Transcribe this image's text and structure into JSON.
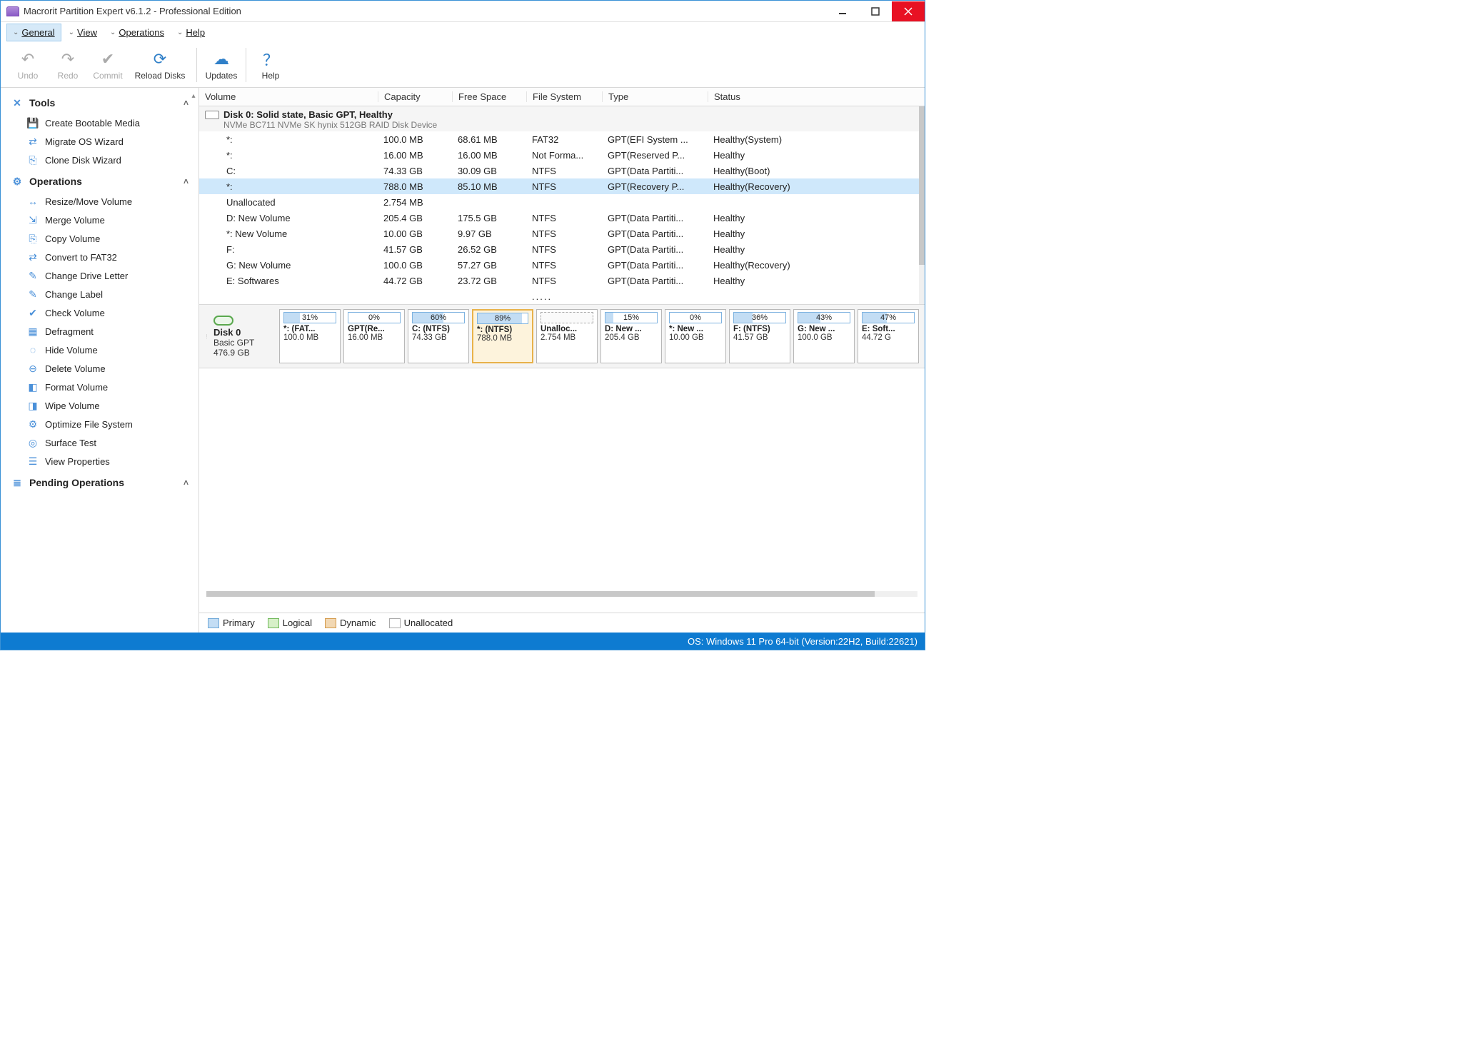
{
  "titlebar": {
    "title": "Macrorit Partition Expert v6.1.2 - Professional Edition"
  },
  "menubar": {
    "general": "General",
    "view": "View",
    "operations": "Operations",
    "help": "Help"
  },
  "toolbar": {
    "undo": "Undo",
    "redo": "Redo",
    "commit": "Commit",
    "reload": "Reload Disks",
    "updates": "Updates",
    "help": "Help"
  },
  "sidebar": {
    "tools": {
      "header": "Tools",
      "items": [
        "Create Bootable Media",
        "Migrate OS Wizard",
        "Clone Disk Wizard"
      ]
    },
    "operations": {
      "header": "Operations",
      "items": [
        "Resize/Move Volume",
        "Merge Volume",
        "Copy Volume",
        "Convert to FAT32",
        "Change Drive Letter",
        "Change Label",
        "Check Volume",
        "Defragment",
        "Hide Volume",
        "Delete Volume",
        "Format Volume",
        "Wipe Volume",
        "Optimize File System",
        "Surface Test",
        "View Properties"
      ]
    },
    "pending": {
      "header": "Pending Operations"
    }
  },
  "table": {
    "headers": {
      "volume": "Volume",
      "capacity": "Capacity",
      "free": "Free Space",
      "fs": "File System",
      "type": "Type",
      "status": "Status"
    },
    "disk": {
      "line1": "Disk 0: Solid state, Basic GPT, Healthy",
      "line2": "NVMe BC711 NVMe SK hynix 512GB RAID Disk Device"
    },
    "rows": [
      {
        "volume": "*:",
        "capacity": "100.0 MB",
        "free": "68.61 MB",
        "fs": "FAT32",
        "type": "GPT(EFI System ...",
        "status": "Healthy(System)"
      },
      {
        "volume": "*:",
        "capacity": "16.00 MB",
        "free": "16.00 MB",
        "fs": "Not Forma...",
        "type": "GPT(Reserved P...",
        "status": "Healthy"
      },
      {
        "volume": "C:",
        "capacity": "74.33 GB",
        "free": "30.09 GB",
        "fs": "NTFS",
        "type": "GPT(Data Partiti...",
        "status": "Healthy(Boot)"
      },
      {
        "volume": "*:",
        "capacity": "788.0 MB",
        "free": "85.10 MB",
        "fs": "NTFS",
        "type": "GPT(Recovery P...",
        "status": "Healthy(Recovery)",
        "selected": true
      },
      {
        "volume": "Unallocated",
        "capacity": "2.754 MB",
        "free": "",
        "fs": "",
        "type": "",
        "status": ""
      },
      {
        "volume": "D: New Volume",
        "capacity": "205.4 GB",
        "free": "175.5 GB",
        "fs": "NTFS",
        "type": "GPT(Data Partiti...",
        "status": "Healthy"
      },
      {
        "volume": "*: New Volume",
        "capacity": "10.00 GB",
        "free": "9.97 GB",
        "fs": "NTFS",
        "type": "GPT(Data Partiti...",
        "status": "Healthy"
      },
      {
        "volume": "F:",
        "capacity": "41.57 GB",
        "free": "26.52 GB",
        "fs": "NTFS",
        "type": "GPT(Data Partiti...",
        "status": "Healthy"
      },
      {
        "volume": "G: New Volume",
        "capacity": "100.0 GB",
        "free": "57.27 GB",
        "fs": "NTFS",
        "type": "GPT(Data Partiti...",
        "status": "Healthy(Recovery)"
      },
      {
        "volume": "E: Softwares",
        "capacity": "44.72 GB",
        "free": "23.72 GB",
        "fs": "NTFS",
        "type": "GPT(Data Partiti...",
        "status": "Healthy"
      },
      {
        "volume": "",
        "capacity": "",
        "free": "",
        "fs": ".....",
        "type": "",
        "status": "",
        "last": true
      }
    ]
  },
  "diskmap": {
    "disk": {
      "name": "Disk 0",
      "sub": "Basic GPT",
      "size": "476.9 GB"
    },
    "parts": [
      {
        "pct": "31%",
        "fill": 31,
        "name": "*: (FAT...",
        "size": "100.0 MB"
      },
      {
        "pct": "0%",
        "fill": 0,
        "name": "GPT(Re...",
        "size": "16.00 MB"
      },
      {
        "pct": "60%",
        "fill": 60,
        "name": "C: (NTFS)",
        "size": "74.33 GB"
      },
      {
        "pct": "89%",
        "fill": 89,
        "name": "*: (NTFS)",
        "size": "788.0 MB",
        "selected": true
      },
      {
        "pct": "",
        "fill": 0,
        "name": "Unalloc...",
        "size": "2.754 MB",
        "unalloc": true
      },
      {
        "pct": "15%",
        "fill": 15,
        "name": "D: New ...",
        "size": "205.4 GB"
      },
      {
        "pct": "0%",
        "fill": 0,
        "name": "*: New ...",
        "size": "10.00 GB"
      },
      {
        "pct": "36%",
        "fill": 36,
        "name": "F: (NTFS)",
        "size": "41.57 GB"
      },
      {
        "pct": "43%",
        "fill": 43,
        "name": "G: New ...",
        "size": "100.0 GB"
      },
      {
        "pct": "47%",
        "fill": 47,
        "name": "E: Soft...",
        "size": "44.72 G"
      }
    ]
  },
  "legend": {
    "primary": "Primary",
    "logical": "Logical",
    "dynamic": "Dynamic",
    "unalloc": "Unallocated"
  },
  "statusbar": {
    "text": "OS: Windows 11 Pro 64-bit (Version:22H2, Build:22621)"
  }
}
